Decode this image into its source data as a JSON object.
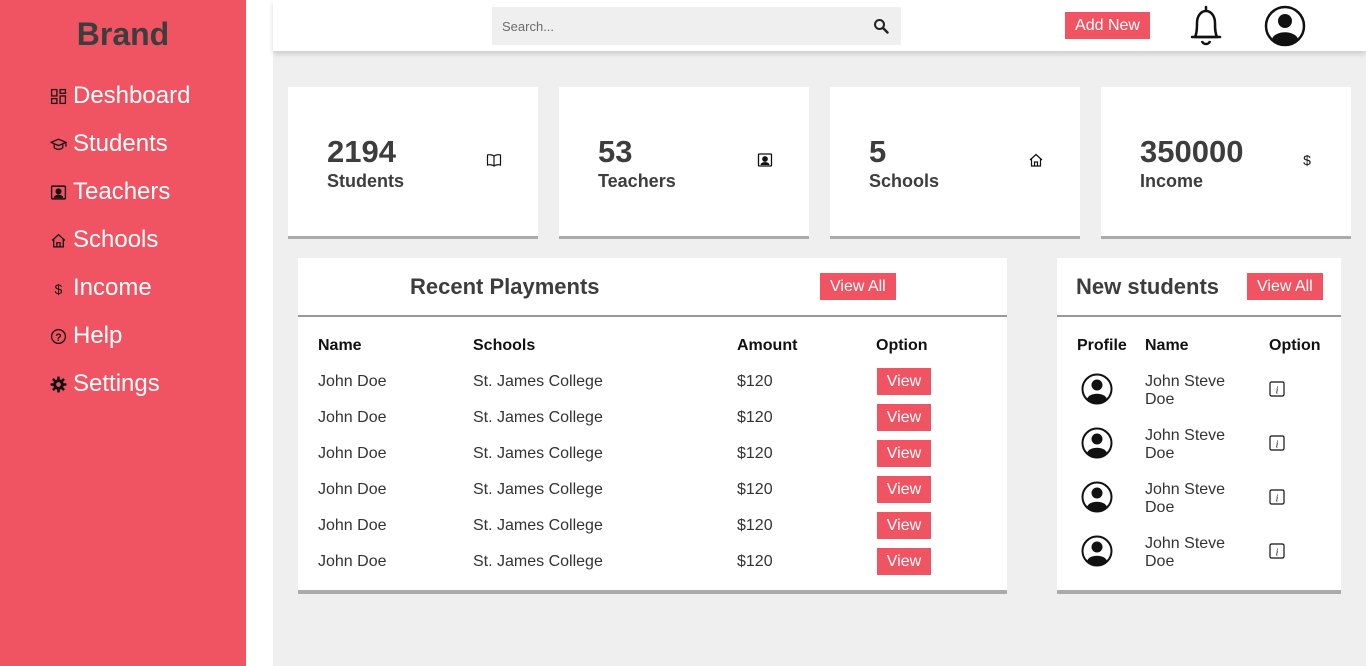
{
  "sidebar": {
    "brand": "Brand",
    "items": [
      {
        "label": "Deshboard",
        "icon": "dashboard-icon"
      },
      {
        "label": "Students",
        "icon": "graduation-cap-icon"
      },
      {
        "label": "Teachers",
        "icon": "person-badge-icon"
      },
      {
        "label": "Schools",
        "icon": "house-icon"
      },
      {
        "label": "Income",
        "icon": "dollar-icon"
      },
      {
        "label": "Help",
        "icon": "question-icon"
      },
      {
        "label": "Settings",
        "icon": "gear-icon"
      }
    ]
  },
  "topbar": {
    "search_placeholder": "Search...",
    "add_new": "Add New"
  },
  "stats": [
    {
      "value": "2194",
      "label": "Students",
      "icon": "book-icon"
    },
    {
      "value": "53",
      "label": "Teachers",
      "icon": "person-badge-icon"
    },
    {
      "value": "5",
      "label": "Schools",
      "icon": "house-icon"
    },
    {
      "value": "350000",
      "label": "Income",
      "icon": "dollar-icon"
    }
  ],
  "payments": {
    "title": "Recent Playments",
    "view_all": "View All",
    "headers": [
      "Name",
      "Schools",
      "Amount",
      "Option"
    ],
    "rows": [
      {
        "name": "John Doe",
        "school": "St. James College",
        "amount": "$120",
        "option": "View"
      },
      {
        "name": "John Doe",
        "school": "St. James College",
        "amount": "$120",
        "option": "View"
      },
      {
        "name": "John Doe",
        "school": "St. James College",
        "amount": "$120",
        "option": "View"
      },
      {
        "name": "John Doe",
        "school": "St. James College",
        "amount": "$120",
        "option": "View"
      },
      {
        "name": "John Doe",
        "school": "St. James College",
        "amount": "$120",
        "option": "View"
      },
      {
        "name": "John Doe",
        "school": "St. James College",
        "amount": "$120",
        "option": "View"
      }
    ]
  },
  "new_students": {
    "title": "New students",
    "view_all": "View All",
    "headers": [
      "Profile",
      "Name",
      "Option"
    ],
    "rows": [
      {
        "name": "John Steve Doe"
      },
      {
        "name": "John Steve Doe"
      },
      {
        "name": "John Steve Doe"
      },
      {
        "name": "John Steve Doe"
      }
    ]
  },
  "colors": {
    "accent": "#f05462",
    "text_dark": "#3d3d3d",
    "background": "#efefef"
  }
}
